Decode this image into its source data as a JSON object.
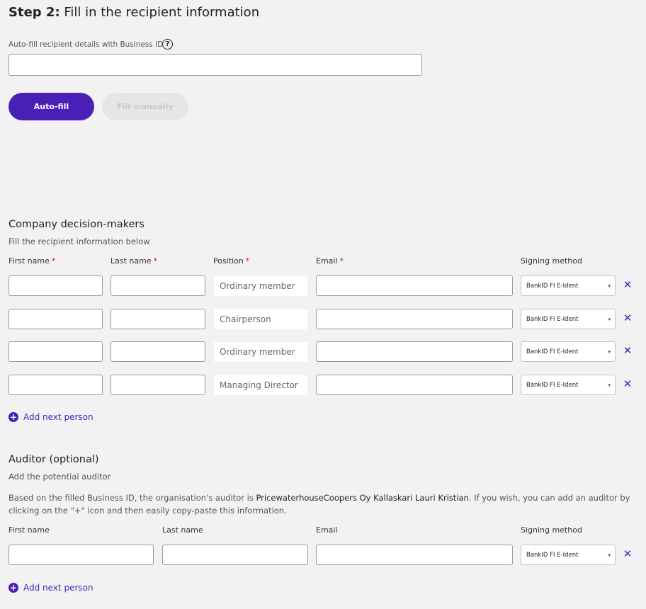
{
  "step": {
    "prefix": "Step 2:",
    "title": "Fill in the recipient information"
  },
  "autofill": {
    "label": "Auto-fill recipient details with Business ID",
    "help_symbol": "?",
    "input_value": "",
    "autofill_button": "Auto-fill",
    "manual_button": "Fill manually"
  },
  "decision_makers": {
    "title": "Company decision-makers",
    "subtitle": "Fill the recipient information below",
    "columns": {
      "first_name": "First name",
      "last_name": "Last name",
      "position": "Position",
      "email": "Email",
      "signing_method": "Signing method",
      "required_marker": "*"
    },
    "rows": [
      {
        "first_name": "",
        "last_name": "",
        "position": "Ordinary member",
        "email": "",
        "signing_method": "BankID FI E-Ident"
      },
      {
        "first_name": "",
        "last_name": "",
        "position": "Chairperson",
        "email": "",
        "signing_method": "BankID FI E-Ident"
      },
      {
        "first_name": "",
        "last_name": "",
        "position": "Ordinary member",
        "email": "",
        "signing_method": "BankID FI E-Ident"
      },
      {
        "first_name": "",
        "last_name": "",
        "position": "Managing Director",
        "email": "",
        "signing_method": "BankID FI E-Ident"
      }
    ],
    "add_label": "Add next person"
  },
  "auditor": {
    "title": "Auditor (optional)",
    "subtitle": "Add the potential auditor",
    "info_before": "Based on the filled Business ID, the organisation's auditor is ",
    "info_name": "PricewaterhouseCoopers Oy Kallaskari Lauri Kristian",
    "info_after": ". If you wish, you can add an auditor by clicking on the \"+\" icon and then easily copy-paste this information.",
    "columns": {
      "first_name": "First name",
      "last_name": "Last name",
      "email": "Email",
      "signing_method": "Signing method"
    },
    "row": {
      "first_name": "",
      "last_name": "",
      "email": "",
      "signing_method": "BankID FI E-Ident"
    },
    "add_label": "Add next person"
  },
  "icons": {
    "remove": "close-icon",
    "add": "plus-circle-icon",
    "dropdown": "chevron-down-icon",
    "help": "help-circle-icon"
  },
  "colors": {
    "accent": "#4a1fb8",
    "required": "#c8102e",
    "background": "#f2f2f2"
  }
}
